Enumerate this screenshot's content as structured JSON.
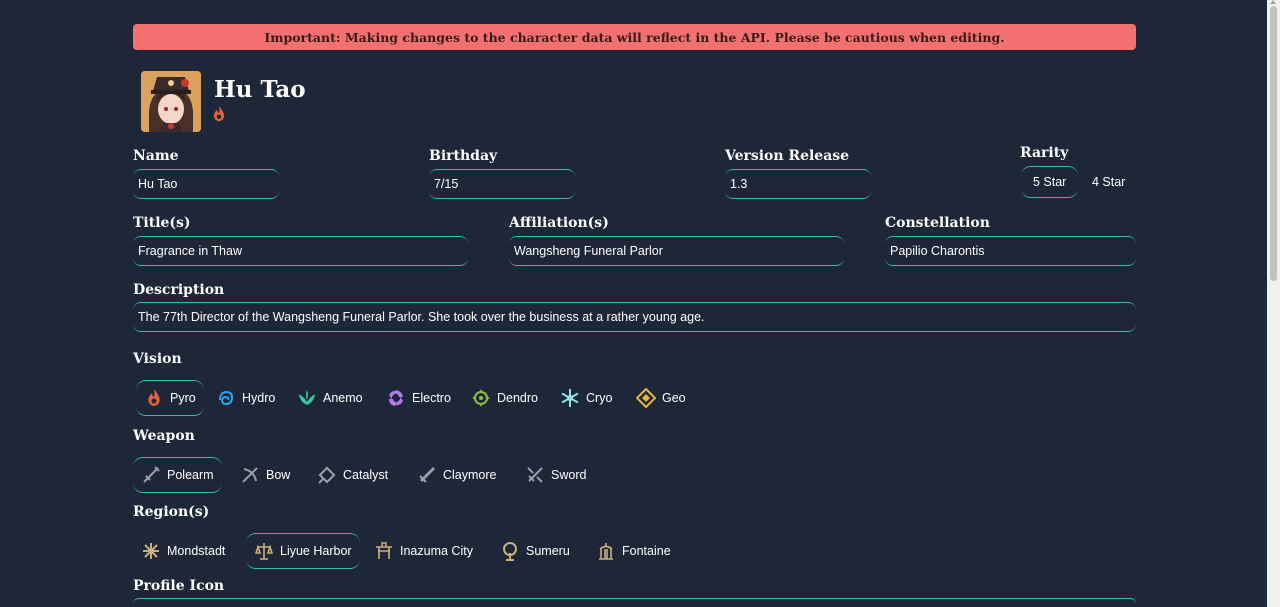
{
  "banner": {
    "text": "Important: Making changes to the character data will reflect in the API. Please be cautious when editing."
  },
  "character": {
    "name": "Hu Tao",
    "element_icon": "pyro-icon"
  },
  "fields": {
    "name": {
      "label": "Name",
      "value": "Hu Tao"
    },
    "birthday": {
      "label": "Birthday",
      "value": "7/15"
    },
    "version": {
      "label": "Version Release",
      "value": "1.3"
    },
    "rarity": {
      "label": "Rarity",
      "options": [
        "5 Star",
        "4 Star"
      ],
      "selected": "5 Star"
    },
    "titles": {
      "label": "Title(s)",
      "value": "Fragrance in Thaw"
    },
    "affiliation": {
      "label": "Affiliation(s)",
      "value": "Wangsheng Funeral Parlor"
    },
    "constellation": {
      "label": "Constellation",
      "value": "Papilio Charontis"
    },
    "description": {
      "label": "Description",
      "value": "The 77th Director of the Wangsheng Funeral Parlor. She took over the business at a rather young age."
    }
  },
  "vision": {
    "label": "Vision",
    "selected": "Pyro",
    "options": [
      {
        "label": "Pyro",
        "icon": "pyro-icon",
        "color": "#e8603c"
      },
      {
        "label": "Hydro",
        "icon": "hydro-icon",
        "color": "#2aa6e6"
      },
      {
        "label": "Anemo",
        "icon": "anemo-icon",
        "color": "#35c8a3"
      },
      {
        "label": "Electro",
        "icon": "electro-icon",
        "color": "#b07ce8"
      },
      {
        "label": "Dendro",
        "icon": "dendro-icon",
        "color": "#8cc33b"
      },
      {
        "label": "Cryo",
        "icon": "cryo-icon",
        "color": "#8fe1e8"
      },
      {
        "label": "Geo",
        "icon": "geo-icon",
        "color": "#e8b43a"
      }
    ]
  },
  "weapon": {
    "label": "Weapon",
    "selected": "Polearm",
    "options": [
      {
        "label": "Polearm",
        "icon": "polearm-icon"
      },
      {
        "label": "Bow",
        "icon": "bow-icon"
      },
      {
        "label": "Catalyst",
        "icon": "catalyst-icon"
      },
      {
        "label": "Claymore",
        "icon": "claymore-icon"
      },
      {
        "label": "Sword",
        "icon": "sword-icon"
      }
    ]
  },
  "region": {
    "label": "Region(s)",
    "selected": "Liyue Harbor",
    "options": [
      {
        "label": "Mondstadt",
        "icon": "mondstadt-icon"
      },
      {
        "label": "Liyue Harbor",
        "icon": "liyue-icon"
      },
      {
        "label": "Inazuma City",
        "icon": "inazuma-icon"
      },
      {
        "label": "Sumeru",
        "icon": "sumeru-icon"
      },
      {
        "label": "Fontaine",
        "icon": "fontaine-icon"
      }
    ]
  },
  "profile_icon": {
    "label": "Profile Icon"
  },
  "colors": {
    "accent": "#2ec4a9",
    "banner": "#f37070",
    "background": "#1e2738"
  }
}
